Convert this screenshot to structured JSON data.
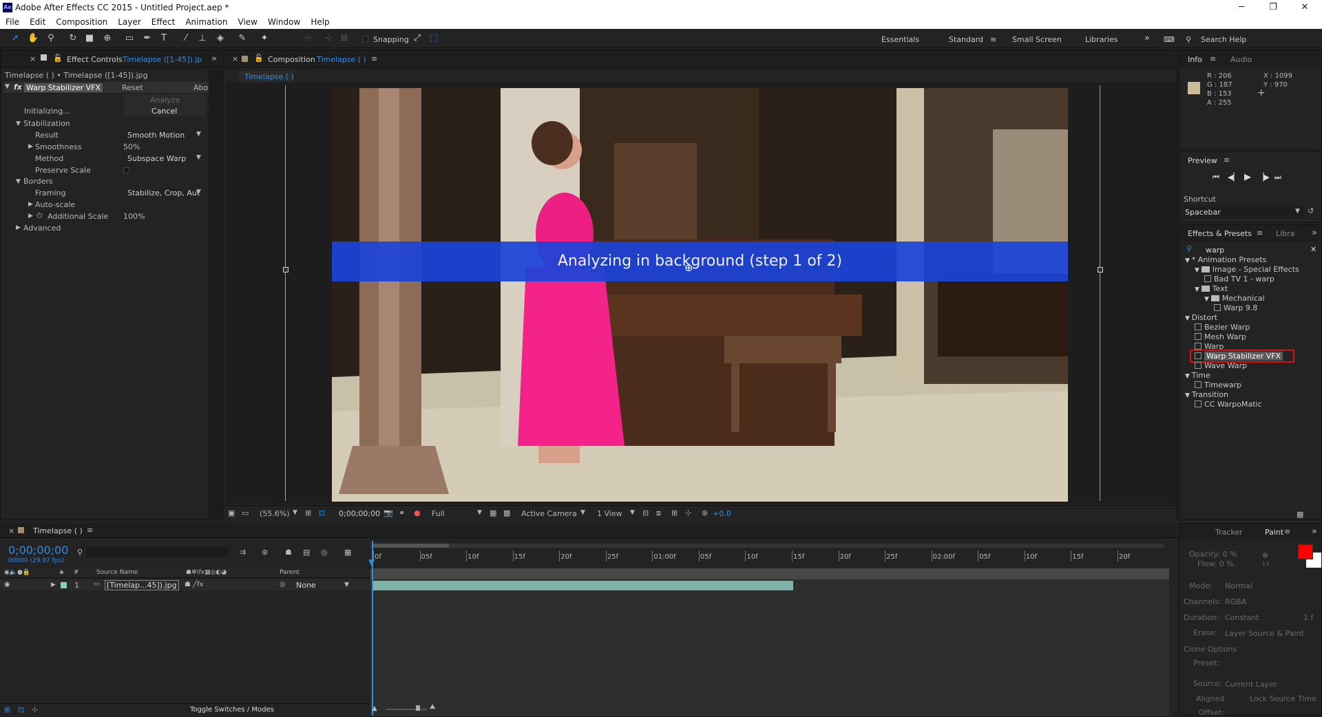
{
  "window": {
    "title": "Adobe After Effects CC 2015 - Untitled Project.aep *",
    "app_icon": "Ae"
  },
  "menu": [
    "File",
    "Edit",
    "Composition",
    "Layer",
    "Effect",
    "Animation",
    "View",
    "Window",
    "Help"
  ],
  "toolbar": {
    "snapping_label": "Snapping",
    "workspaces": [
      "Essentials",
      "Standard",
      "Small Screen",
      "Libraries"
    ],
    "active_workspace": "Standard",
    "search_help": "Search Help"
  },
  "effect_controls": {
    "tab_label": "Effect Controls",
    "tab_target": "Timelapse ([1-45]).jp",
    "breadcrumb": "Timelapse ( ) • Timelapse ([1-45]).jpg",
    "effect_name": "Warp Stabilizer VFX",
    "reset": "Reset",
    "about": "Abo",
    "analyze": "Analyze",
    "initializing": "Initializing...",
    "cancel": "Cancel",
    "stabilization": "Stabilization",
    "result_label": "Result",
    "result_value": "Smooth Motion",
    "smoothness_label": "Smoothness",
    "smoothness_value": "50%",
    "method_label": "Method",
    "method_value": "Subspace Warp",
    "preserve_scale_label": "Preserve Scale",
    "borders": "Borders",
    "framing_label": "Framing",
    "framing_value": "Stabilize, Crop, Aut",
    "autoscale": "Auto-scale",
    "additional_scale_label": "Additional Scale",
    "additional_scale_value": "100%",
    "advanced": "Advanced"
  },
  "composition": {
    "tab_label": "Composition",
    "tab_target": "Timelapse ( )",
    "subtab": "Timelapse ( )",
    "banner": "Analyzing in background (step 1 of 2)",
    "zoom": "(55.6%)",
    "timecode": "0;00;00;00",
    "resolution": "Full",
    "camera": "Active Camera",
    "view": "1 View",
    "exposure": "+0.0"
  },
  "info": {
    "tab": "Info",
    "tab2": "Audio",
    "r": "R : 206",
    "g": "G : 187",
    "b": "B : 153",
    "a": "A : 255",
    "x": "X : 1099",
    "y": "Y : 970",
    "swatch": "#cebb99"
  },
  "preview": {
    "title": "Preview",
    "shortcut_label": "Shortcut",
    "shortcut_value": "Spacebar"
  },
  "effects_presets": {
    "tab": "Effects & Presets",
    "tab2": "Libra",
    "search": "warp",
    "tree": [
      {
        "label": "* Animation Presets",
        "kind": "group",
        "level": 0
      },
      {
        "label": "Image - Special Effects",
        "kind": "folder",
        "level": 1
      },
      {
        "label": "Bad TV 1 - warp",
        "kind": "preset",
        "level": 2
      },
      {
        "label": "Text",
        "kind": "folder",
        "level": 1
      },
      {
        "label": "Mechanical",
        "kind": "folder",
        "level": 2
      },
      {
        "label": "Warp 9.8",
        "kind": "preset",
        "level": 3
      },
      {
        "label": "Distort",
        "kind": "group",
        "level": 0
      },
      {
        "label": "Bezier Warp",
        "kind": "effect",
        "level": 1
      },
      {
        "label": "Mesh Warp",
        "kind": "effect",
        "level": 1
      },
      {
        "label": "Warp",
        "kind": "effect",
        "level": 1
      },
      {
        "label": "Warp Stabilizer VFX",
        "kind": "effect",
        "level": 1,
        "selected": true
      },
      {
        "label": "Wave Warp",
        "kind": "effect",
        "level": 1
      },
      {
        "label": "Time",
        "kind": "group",
        "level": 0
      },
      {
        "label": "Timewarp",
        "kind": "effect",
        "level": 1
      },
      {
        "label": "Transition",
        "kind": "group",
        "level": 0
      },
      {
        "label": "CC WarpoMatic",
        "kind": "effect",
        "level": 1
      }
    ]
  },
  "paint": {
    "tab1": "Tracker",
    "tab2": "Paint",
    "opacity": "Opacity: 0 %",
    "flow": "Flow: 0 %",
    "mode_label": "Mode:",
    "mode_value": "Normal",
    "channels_label": "Channels:",
    "channels_value": "RGBA",
    "duration_label": "Duration:",
    "duration_value": "Constant",
    "duration_frames": "1 f",
    "erase_label": "Erase:",
    "erase_value": "Layer Source & Paint",
    "clone_options": "Clone Options",
    "preset_label": "Preset:",
    "source_label": "Source:",
    "source_value": "Current Layer",
    "aligned": "Aligned",
    "lock_source_time": "Lock Source Time",
    "offset": "Offset:",
    "brush_size": "13",
    "fg_color": "#ff0000",
    "bg_color": "#ffffff"
  },
  "timeline": {
    "tab": "Timelapse ( )",
    "timecode": "0;00;00;00",
    "frame_info": "00000 (29.97 fps)",
    "col_number": "#",
    "col_source": "Source Name",
    "col_parent": "Parent",
    "layer_number": "1",
    "layer_name": "[Timelap...45]).jpg",
    "layer_parent": "None",
    "ruler": [
      "0f",
      "05f",
      "10f",
      "15f",
      "20f",
      "25f",
      "01:00f",
      "05f",
      "10f",
      "15f",
      "20f",
      "25f",
      "02:00f",
      "05f",
      "10f",
      "15f",
      "20f"
    ],
    "toggle_label": "Toggle Switches / Modes"
  }
}
